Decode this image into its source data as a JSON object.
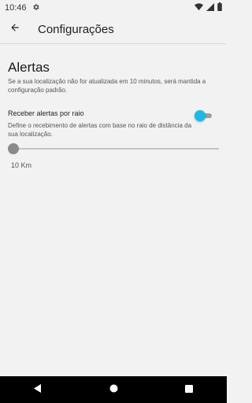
{
  "status_bar": {
    "time": "10:46",
    "icons": [
      "settings-icon",
      "wifi-icon",
      "signal-icon",
      "battery-icon"
    ]
  },
  "toolbar": {
    "title": "Configurações",
    "back_icon": "arrow-back-icon"
  },
  "section": {
    "title": "Alertas",
    "description": "Se a sua localização não for atualizada em 10 minutos, será mantida a configuração padrão."
  },
  "preference": {
    "title": "Receber alertas por raio",
    "summary": "Define o recebimento de alertas com base no raio de distância da sua localização.",
    "toggle_on": true
  },
  "slider": {
    "value_label": "10 Km",
    "level": 0
  },
  "colors": {
    "accent": "#1ab9e8",
    "background": "#f2f2f2",
    "nav_bar": "#000000"
  },
  "nav_bar": {
    "icons": [
      "back-triangle-icon",
      "home-circle-icon",
      "recents-square-icon"
    ]
  }
}
